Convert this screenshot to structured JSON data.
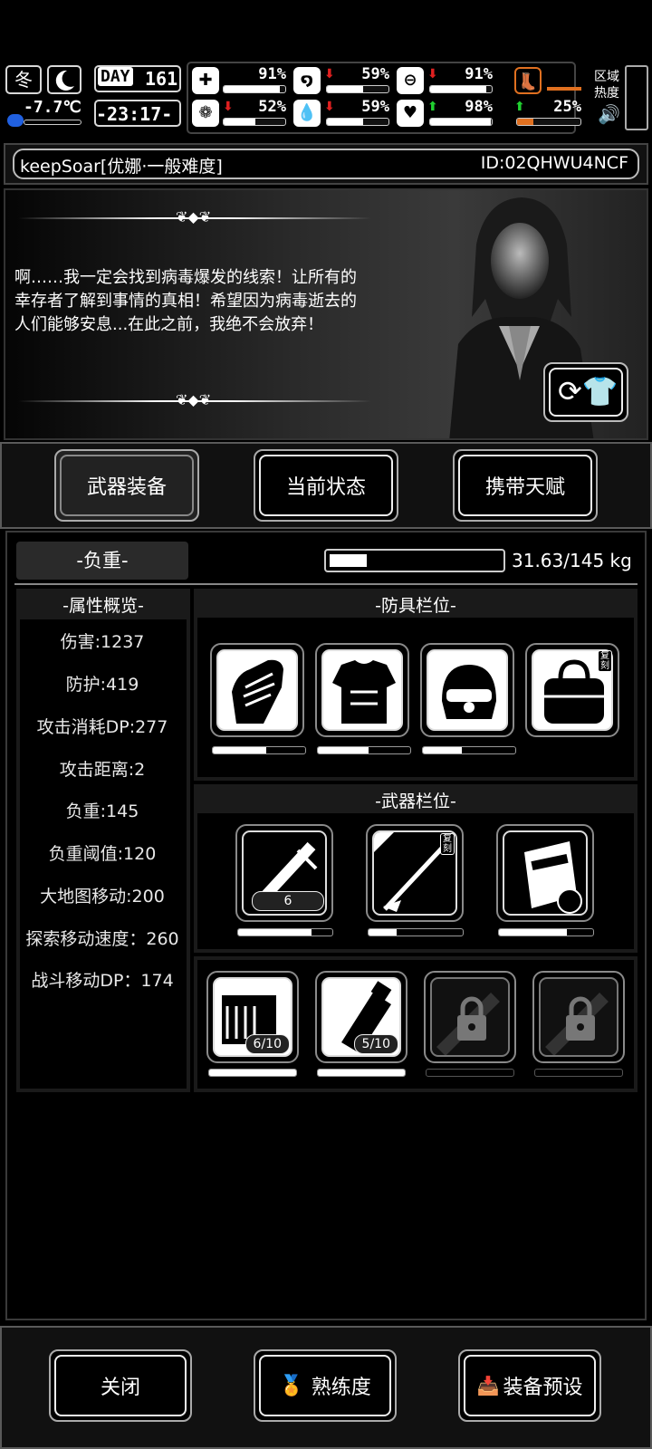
{
  "hud": {
    "season": "冬",
    "temperature": "-7.7℃",
    "day_label": "DAY",
    "day_number": "161",
    "time": "-23:17-",
    "stats": [
      {
        "name": "health",
        "icon": "first-aid-icon",
        "value": "91%",
        "fill": 0.91,
        "trend": ""
      },
      {
        "name": "hunger",
        "icon": "stomach-icon",
        "value": "59%",
        "fill": 0.59,
        "trend": "down"
      },
      {
        "name": "stamina",
        "icon": "capsule-icon",
        "value": "91%",
        "fill": 0.91,
        "trend": "down"
      },
      {
        "name": "sanity",
        "icon": "brain-icon",
        "value": "52%",
        "fill": 0.52,
        "trend": "down"
      },
      {
        "name": "thirst",
        "icon": "water-drop-icon",
        "value": "59%",
        "fill": 0.59,
        "trend": "down"
      },
      {
        "name": "mood",
        "icon": "heart-icon",
        "value": "98%",
        "fill": 0.98,
        "trend": "up"
      },
      {
        "name": "infection",
        "icon": "boot-icon",
        "value": "25%",
        "fill": 0.25,
        "trend": "up"
      }
    ],
    "region_heat_label": "区域热度"
  },
  "player": {
    "name": "keepSoar[优娜·一般难度]",
    "id": "ID:02QHWU4NCF"
  },
  "story": {
    "text": "啊……我一定会找到病毒爆发的线索！让所有的幸存者了解到事情的真相！希望因为病毒逝去的人们能够安息...在此之前，我绝不会放弃！"
  },
  "tabs": [
    "武器装备",
    "当前状态",
    "携带天赋"
  ],
  "load": {
    "label": "-负重-",
    "value": "31.63/145 kg",
    "fill": 0.22
  },
  "attributes": {
    "title": "-属性概览-",
    "items": [
      "伤害:1237",
      "防护:419",
      "攻击消耗DP:277",
      "攻击距离:2",
      "负重:145",
      "负重阈值:120",
      "大地图移动:200",
      "探索移动速度：260",
      "战斗移动DP：174"
    ]
  },
  "armor": {
    "title": "-防具栏位-",
    "slots": [
      {
        "icon": "gloves-icon",
        "durability": 0.58
      },
      {
        "icon": "body-armor-icon",
        "durability": 0.55
      },
      {
        "icon": "helmet-icon",
        "durability": 0.42
      },
      {
        "icon": "bag-icon",
        "badge": "复刻"
      }
    ]
  },
  "weapons": {
    "title": "-武器栏位-",
    "slots": [
      {
        "icon": "minigun-icon",
        "count": "6",
        "durability": 0.78
      },
      {
        "icon": "sniper-rifle-icon",
        "badge": "复刻",
        "durability": 0.3
      },
      {
        "icon": "riot-shield-icon",
        "durability": 0.72
      }
    ]
  },
  "consumables": {
    "slots": [
      {
        "icon": "ammo-crate-icon",
        "count": "6/10",
        "fill": 1.0
      },
      {
        "icon": "canteen-icon",
        "count": "5/10",
        "fill": 1.0
      },
      {
        "icon": "locked-slot-icon"
      },
      {
        "icon": "locked-slot-icon"
      }
    ]
  },
  "footer": {
    "close": "关闭",
    "proficiency": "熟练度",
    "preset": "装备预设"
  }
}
